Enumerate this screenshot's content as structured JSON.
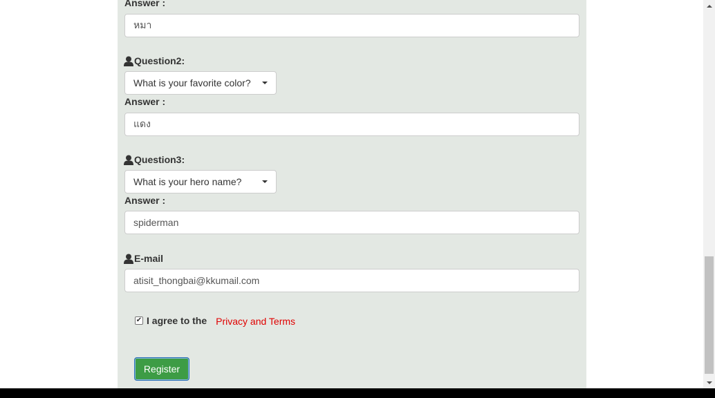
{
  "form": {
    "answer_label": "Answer :",
    "q1_answer": "หมา",
    "question2": {
      "label": "Question2:",
      "selected": "What is your favorite color?",
      "answer_label": "Answer :",
      "answer_value": "แดง"
    },
    "question3": {
      "label": "Question3:",
      "selected": "What is your hero name?",
      "answer_label": "Answer :",
      "answer_value": "spiderman"
    },
    "email": {
      "label": "E-mail",
      "value": "atisit_thongbai@kkumail.com"
    },
    "agree": {
      "checked": true,
      "text": "I agree to the",
      "link_text": "Privacy and Terms",
      "link_color": "#e00000"
    },
    "register_label": "Register"
  },
  "colors": {
    "panel_bg": "#e3e8e3",
    "register_bg": "#3d9c45"
  },
  "icons": {
    "user": "user-icon",
    "caret": "chevron-down-icon"
  }
}
